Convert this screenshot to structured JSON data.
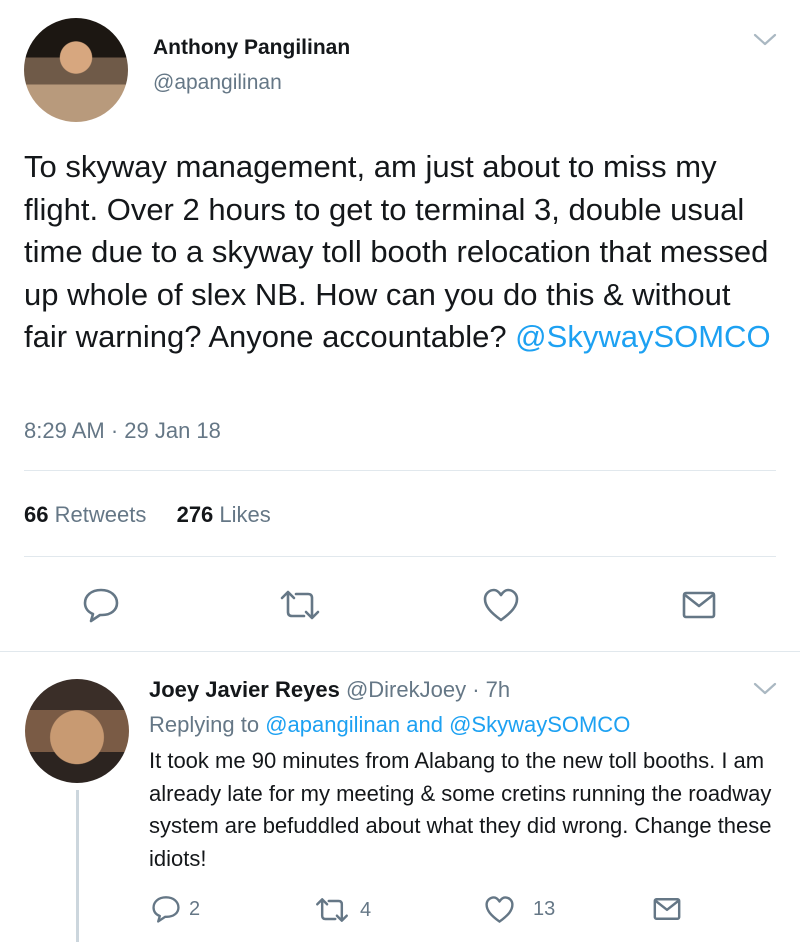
{
  "tweet": {
    "author_name": "Anthony Pangilinan",
    "author_handle": "@apangilinan",
    "text_before_mention": "To skyway management, am just about to miss my flight. Over 2 hours to get to terminal 3, double usual time due to a skyway toll booth relocation that messed up whole of slex NB. How can you do this & without fair warning? Anyone accountable? ",
    "mention": "@SkywaySOMCO",
    "timestamp": "8:29 AM · 29 Jan 18",
    "retweets_count": "66",
    "retweets_label": "Retweets",
    "likes_count": "276",
    "likes_label": "Likes",
    "actions": [
      "reply-icon",
      "retweet-icon",
      "like-icon",
      "share-icon"
    ]
  },
  "reply": {
    "author_name": "Joey Javier Reyes",
    "author_handle": "@DirekJoey",
    "time": "· 7h",
    "replying_label": "Replying to",
    "replying_mention1": "@apangilinan",
    "replying_and": "and",
    "replying_mention2": "@SkywaySOMCO",
    "text": "It took me 90 minutes from Alabang to the new toll booths. I am already late for my meeting & some cretins running the roadway system are befuddled about what they did wrong. Change these idiots!",
    "reply_count": "2",
    "retweet_count": "4",
    "like_count": "13"
  },
  "colors": {
    "link": "#1da1f2",
    "secondary": "#657786",
    "divider": "#e1e8ed"
  }
}
